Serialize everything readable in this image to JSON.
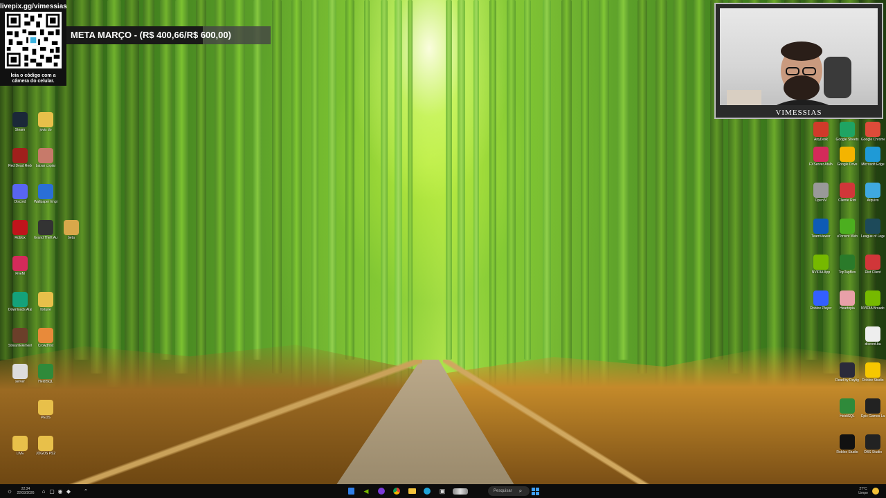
{
  "overlay": {
    "qr_url": "livepix.gg/vimessias",
    "qr_hint_line1": "leia o código com a",
    "qr_hint_line2": "câmera do celular.",
    "goal_text": "META MARÇO - (R$ 400,66/R$ 600,00)",
    "goal_progress": 0.6678,
    "webcam_name": "VIMESSIAS"
  },
  "desktop_icons_left": [
    {
      "label": "Steam",
      "icon": "steam-icon",
      "color": "#1b2838"
    },
    {
      "label": "jovis do",
      "icon": "folder-icon",
      "color": "#e8c04a"
    },
    {
      "label": "Red Dead Redempt",
      "icon": "rdr-icon",
      "color": "#a0201c"
    },
    {
      "label": "baixar copiar",
      "icon": "photo-icon",
      "color": "#c77a6a"
    },
    {
      "label": "Discord",
      "icon": "discord-icon",
      "color": "#5865f2"
    },
    {
      "label": "Wallpaper Engine",
      "icon": "wallpaper-engine-icon",
      "color": "#2a6fd6"
    },
    {
      "label": "Roblox",
      "icon": "app-icon",
      "color": "#c0141b"
    },
    {
      "label": "Grand Theft Auto V",
      "icon": "gta-icon",
      "color": "#333333"
    },
    {
      "label": "beta",
      "icon": "folder-icon",
      "color": "#d8a84a"
    },
    {
      "label": "FiveM",
      "icon": "fivem-icon",
      "color": "#d42a5a"
    },
    {
      "label": "Downloads Atalho",
      "icon": "download-icon",
      "color": "#14a27a"
    },
    {
      "label": "fortune",
      "icon": "folder-icon",
      "color": "#e8c04a"
    },
    {
      "label": "StreamElements SE.Live",
      "icon": "streamelements-icon",
      "color": "#6b3f2a"
    },
    {
      "label": "Crowdfirst",
      "icon": "crowdfirst-icon",
      "color": "#e88a3a"
    },
    {
      "label": "server",
      "icon": "gear-icon",
      "color": "#dddddd"
    },
    {
      "label": "HeidiSQL",
      "icon": "heidisql-icon",
      "color": "#2f8a3a"
    },
    {
      "label": "PEDS",
      "icon": "folder-icon",
      "color": "#e8c04a"
    },
    {
      "label": "LIVE",
      "icon": "folder-icon",
      "color": "#e8c04a"
    },
    {
      "label": "JOGOS PS2",
      "icon": "folder-icon",
      "color": "#e8c04a"
    }
  ],
  "desktop_icons_right": [
    {
      "label": "AnyDesk",
      "icon": "anydesk-icon",
      "color": "#d03a2a"
    },
    {
      "label": "Google Sheets",
      "icon": "sheets-icon",
      "color": "#1fa463"
    },
    {
      "label": "Google Chrome",
      "icon": "chrome-icon",
      "color": "#dd4b39"
    },
    {
      "label": "FXServer Atalho",
      "icon": "fxserver-icon",
      "color": "#d42a5a"
    },
    {
      "label": "Google Drive",
      "icon": "drive-icon",
      "color": "#f4b400"
    },
    {
      "label": "Microsoft Edge",
      "icon": "edge-icon",
      "color": "#1f9ad6"
    },
    {
      "label": "OpenIV",
      "icon": "openiv-icon",
      "color": "#999999"
    },
    {
      "label": "Cliente Riot",
      "icon": "riot-icon",
      "color": "#d13639"
    },
    {
      "label": "Arquivo",
      "icon": "file-icon",
      "color": "#3fa9e0"
    },
    {
      "label": "TeamViewer",
      "icon": "teamviewer-icon",
      "color": "#0e5bb5"
    },
    {
      "label": "uTorrent Web",
      "icon": "utorrent-icon",
      "color": "#4caf1f"
    },
    {
      "label": "League of Legends",
      "icon": "lol-icon",
      "color": "#1d4a5a"
    },
    {
      "label": "NVIDIA App",
      "icon": "nvidia-icon",
      "color": "#76b900"
    },
    {
      "label": "TopTapBox",
      "icon": "top-icon",
      "color": "#2a7a2a"
    },
    {
      "label": "Riot Client",
      "icon": "riot-icon",
      "color": "#d13639"
    },
    {
      "label": "Roblox Player",
      "icon": "roblox-icon",
      "color": "#335fff"
    },
    {
      "label": "Heartopia",
      "icon": "heartopia-icon",
      "color": "#e8a0a8"
    },
    {
      "label": "NVIDIA Broadcast",
      "icon": "nvidia-broadcast-icon",
      "color": "#76b900"
    },
    {
      "label": "discord.ba",
      "icon": "file-icon",
      "color": "#eeeeee"
    },
    {
      "label": "Dead by Daylight",
      "icon": "dbd-icon",
      "color": "#2a2a3a"
    },
    {
      "label": "Roblox Studio",
      "icon": "roblox-studio-icon",
      "color": "#f6c700"
    },
    {
      "label": "HeidiSQL",
      "icon": "heidisql-icon",
      "color": "#2f8a3a"
    },
    {
      "label": "Epic Games Launcher",
      "icon": "epic-icon",
      "color": "#222222"
    },
    {
      "label": "Roblox Studio",
      "icon": "roblox-studio-icon",
      "color": "#111111"
    },
    {
      "label": "OBS Studio",
      "icon": "obs-icon",
      "color": "#222222"
    }
  ],
  "taskbar": {
    "left_time": "22:34",
    "left_date": "22/03/2026",
    "search_placeholder": "Pesquisar",
    "weather_temp": "27°C",
    "weather_desc": "Limpo"
  }
}
